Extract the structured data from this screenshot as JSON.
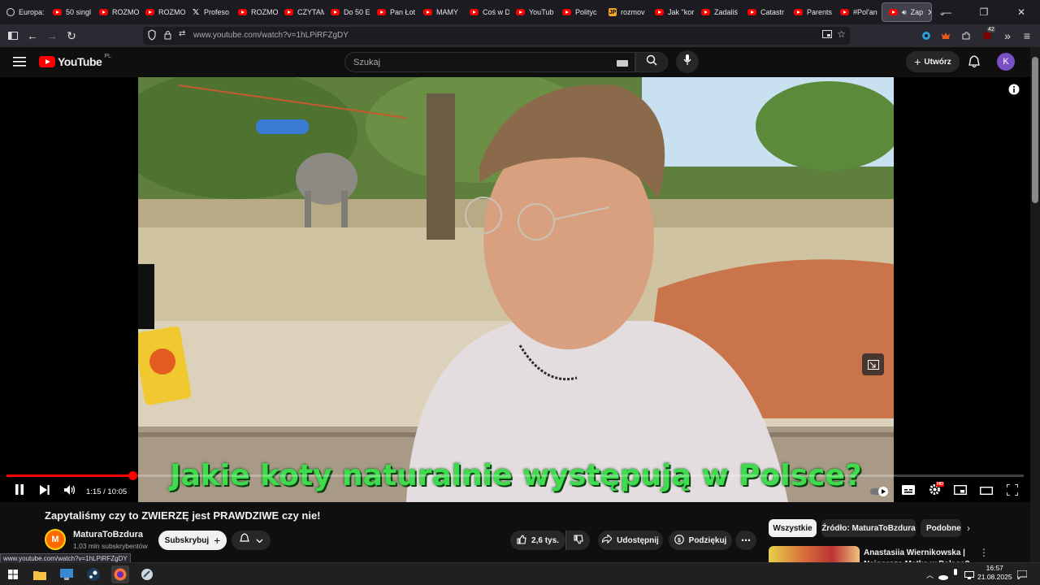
{
  "browser": {
    "tabs": [
      {
        "label": "Europa:",
        "icon": "globe-icon"
      },
      {
        "label": "50 singl",
        "icon": "youtube-icon"
      },
      {
        "label": "ROZMO",
        "icon": "youtube-icon"
      },
      {
        "label": "ROZMO",
        "icon": "youtube-icon"
      },
      {
        "label": "Profeso",
        "icon": "x-icon"
      },
      {
        "label": "ROZMO",
        "icon": "youtube-icon"
      },
      {
        "label": "CZYTAM",
        "icon": "youtube-icon"
      },
      {
        "label": "Do 50 Ε",
        "icon": "youtube-icon"
      },
      {
        "label": "Pan Łot",
        "icon": "youtube-icon"
      },
      {
        "label": "MAMY",
        "icon": "youtube-icon"
      },
      {
        "label": "Coś w D",
        "icon": "youtube-icon"
      },
      {
        "label": "YouTub",
        "icon": "youtube-icon"
      },
      {
        "label": "Polityc",
        "icon": "youtube-icon"
      },
      {
        "label": "rozmov",
        "icon": "jp-icon"
      },
      {
        "label": "Jak \"kor",
        "icon": "youtube-icon"
      },
      {
        "label": "Zadaliś",
        "icon": "youtube-icon"
      },
      {
        "label": "Catastr",
        "icon": "youtube-icon"
      },
      {
        "label": "Parents",
        "icon": "youtube-icon"
      },
      {
        "label": "#Pol'an",
        "icon": "youtube-icon"
      }
    ],
    "active_tab": {
      "label": "Zap"
    },
    "url": "www.youtube.com/watch?v=1hLPiRFZgDY",
    "extension_badge": "42",
    "status_url": "www.youtube.com/watch?v=1hLPiRFZgDY"
  },
  "youtube": {
    "logo_text": "YouTube",
    "region": "PL",
    "search_placeholder": "Szukaj",
    "create_label": "Utwórz",
    "avatar_letter": "K"
  },
  "player": {
    "caption": "Jakie koty naturalnie występują w Polsce?",
    "time": "1:15 / 10:05",
    "progress": 0.124,
    "hd_badge": "HD",
    "mic_logo": "M"
  },
  "video_info": {
    "title": "Zapytaliśmy czy to ZWIERZĘ jest PRAWDZIWE czy nie!",
    "channel": "MaturaToBzdura",
    "channel_initial": "M",
    "subscribers": "1,03 mln subskrybentów",
    "subscribe_label": "Subskrybuj",
    "likes": "2,6 tys.",
    "share_label": "Udostępnij",
    "thanks_label": "Podziękuj"
  },
  "sidebar": {
    "chips": [
      "Wszystkie",
      "Źródło: MaturaToBzdura",
      "Podobne"
    ],
    "recommendation_title": "Anastasiia Wiernikowska | Najgorsza Matka w Polsce?"
  },
  "taskbar": {
    "time": "16:57",
    "date": "21.08.2025"
  },
  "colors": {
    "accent_red": "#ff0000",
    "caption_green": "#3edb4c",
    "avatar_purple": "#7b4fc4"
  }
}
